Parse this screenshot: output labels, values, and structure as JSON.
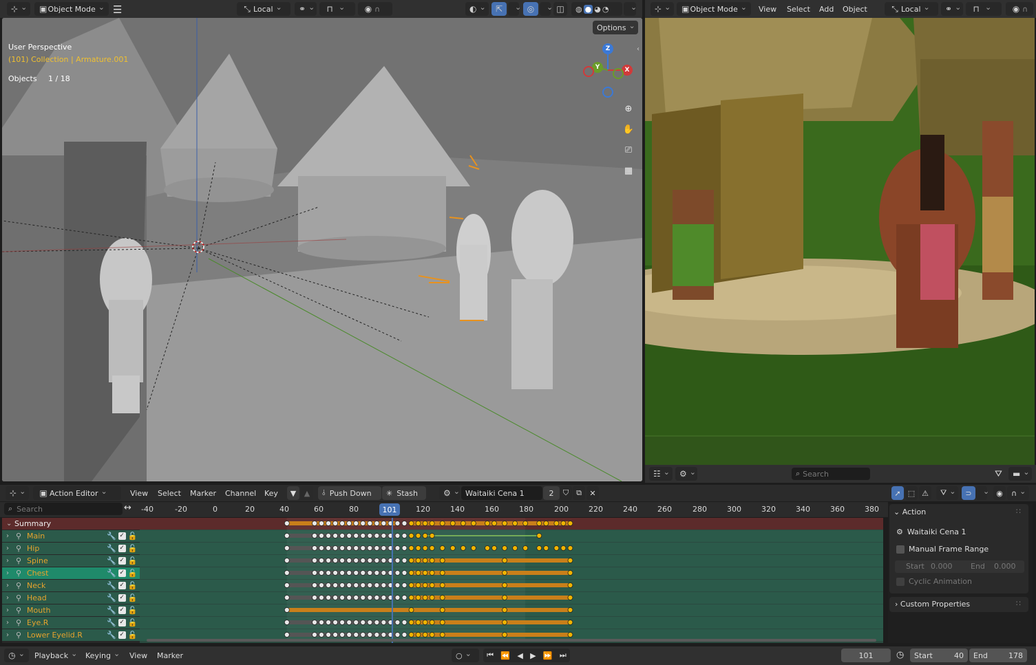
{
  "top_left_header": {
    "mode": "Object Mode",
    "transform_orientation": "Local",
    "options": "Options"
  },
  "viewport_left": {
    "perspective": "User Perspective",
    "collection": "(101) Collection | Armature.001",
    "objects_label": "Objects",
    "objects_count": "1 / 18",
    "gizmo": {
      "z": "Z",
      "y": "Y",
      "x": "X"
    }
  },
  "top_right_header": {
    "mode": "Object Mode",
    "menus": [
      "View",
      "Select",
      "Add",
      "Object"
    ],
    "transform_orientation": "Local"
  },
  "right_footer": {
    "search_placeholder": "Search"
  },
  "action_editor": {
    "editor_type": "Action Editor",
    "menus": [
      "View",
      "Select",
      "Marker",
      "Channel",
      "Key"
    ],
    "push_down": "Push Down",
    "stash": "Stash",
    "action_name": "Waitaiki Cena 1",
    "users": "2",
    "search_placeholder": "Search",
    "ruler": [
      "-40",
      "-20",
      "0",
      "20",
      "40",
      "60",
      "80",
      "101",
      "120",
      "140",
      "160",
      "180",
      "200",
      "220",
      "240",
      "260",
      "280",
      "300",
      "320",
      "340",
      "360",
      "380"
    ],
    "current_frame": "101",
    "summary_label": "Summary",
    "channels": [
      {
        "name": "Main"
      },
      {
        "name": "Hip"
      },
      {
        "name": "Spine"
      },
      {
        "name": "Chest"
      },
      {
        "name": "Neck"
      },
      {
        "name": "Head"
      },
      {
        "name": "Mouth"
      },
      {
        "name": "Eye.R"
      },
      {
        "name": "Lower Eyelid.R"
      }
    ]
  },
  "properties": {
    "action_header": "Action",
    "action_name": "Waitaiki Cena 1",
    "manual_frame_range": "Manual Frame Range",
    "start_label": "Start",
    "start_value": "0.000",
    "end_label": "End",
    "end_value": "0.000",
    "cyclic": "Cyclic Animation",
    "custom_props": "Custom Properties"
  },
  "timeline": {
    "menus": [
      "Playback",
      "Keying",
      "View",
      "Marker"
    ],
    "frame": "101",
    "start_label": "Start",
    "start_value": "40",
    "end_label": "End",
    "end_value": "178"
  },
  "colors": {
    "accent": "#4772b3",
    "keyframe_selected": "#f0b400",
    "channel_bg": "#2b5a4a",
    "orange_bar": "#c97f1a",
    "summary_bg": "#6b2b2b"
  }
}
